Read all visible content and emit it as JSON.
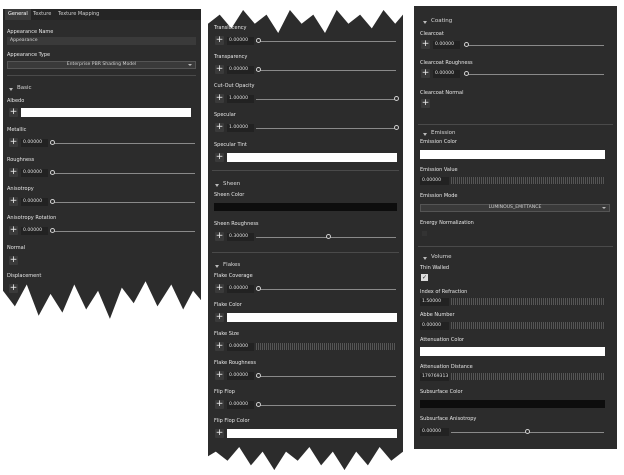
{
  "tabs": [
    "General",
    "Texture",
    "Texture Mapping"
  ],
  "panel1": {
    "appearance_name_label": "Appearance Name",
    "appearance_name_value": "Appearance",
    "appearance_type_label": "Appearance Type",
    "appearance_type_value": "Enterprise PBR Shading Model",
    "basic_section": "Basic",
    "albedo_label": "Albedo",
    "metallic_label": "Metallic",
    "metallic_value": "0.00000",
    "roughness_label": "Roughness",
    "roughness_value": "0.00000",
    "anisotropy_label": "Anisotropy",
    "anisotropy_value": "0.00000",
    "anisotropy_rotation_label": "Anisotropy Rotation",
    "anisotropy_rotation_value": "0.00000",
    "normal_label": "Normal",
    "displacement_label": "Displacement"
  },
  "panel2": {
    "translucency_label": "Translucency",
    "translucency_value": "0.00000",
    "transparency_label": "Transparency",
    "transparency_value": "0.00000",
    "cutout_label": "Cut-Out Opacity",
    "cutout_value": "1.00000",
    "specular_label": "Specular",
    "specular_value": "1.00000",
    "specular_tint_label": "Specular Tint",
    "sheen_section": "Sheen",
    "sheen_color_label": "Sheen Color",
    "sheen_roughness_label": "Sheen Roughness",
    "sheen_roughness_value": "0.30000",
    "flakes_section": "Flakes",
    "flake_coverage_label": "Flake Coverage",
    "flake_coverage_value": "0.00000",
    "flake_color_label": "Flake Color",
    "flake_size_label": "Flake Size",
    "flake_size_value": "0.00000",
    "flake_roughness_label": "Flake Roughness",
    "flake_roughness_value": "0.00000",
    "flip_flop_label": "Flip Flop",
    "flip_flop_value": "0.00000",
    "flip_flop_color_label": "Flip Flop Color"
  },
  "panel3": {
    "coating_section": "Coating",
    "clearcoat_label": "Clearcoat",
    "clearcoat_value": "0.00000",
    "clearcoat_roughness_label": "Clearcoat Roughness",
    "clearcoat_roughness_value": "0.00000",
    "clearcoat_normal_label": "Clearcoat Normal",
    "emission_section": "Emission",
    "emission_color_label": "Emission Color",
    "emission_value_label": "Emission Value",
    "emission_value_value": "0.00000",
    "emission_mode_label": "Emission Mode",
    "emission_mode_value": "LUMINOUS_EMITTANCE",
    "energy_normalization_label": "Energy Normalization",
    "volume_section": "Volume",
    "thin_walled_label": "Thin Walled",
    "ior_label": "Index of Refraction",
    "ior_value": "1.50000",
    "abbe_label": "Abbe Number",
    "abbe_value": "0.00000",
    "attenuation_color_label": "Attenuation Color",
    "attenuation_distance_label": "Attenuation Distance",
    "attenuation_distance_value": "179769313",
    "subsurface_color_label": "Subsurface Color",
    "subsurface_anisotropy_label": "Subsurface Anisotropy",
    "subsurface_anisotropy_value": "0.00000"
  },
  "colors": {
    "panel_bg": "#2c2c2c",
    "swatch_white": "#ffffff",
    "swatch_black": "#0d0d0d"
  }
}
